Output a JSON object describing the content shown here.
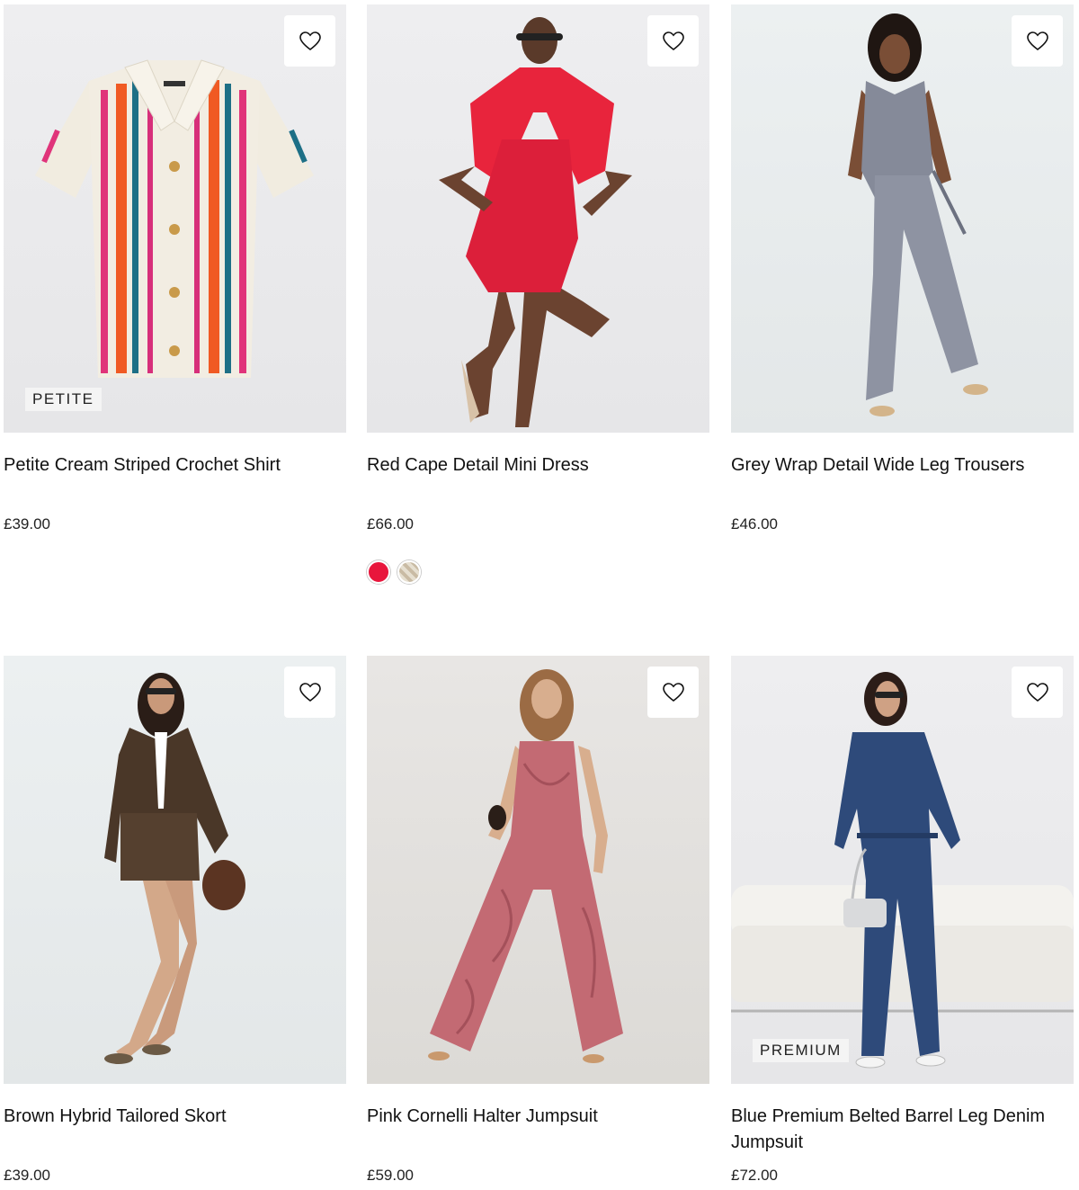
{
  "products": [
    {
      "title": "Petite Cream Striped Crochet Shirt",
      "price": "£39.00",
      "badge": "PETITE"
    },
    {
      "title": "Red Cape Detail Mini Dress",
      "price": "£66.00",
      "swatches": [
        "#e8163c",
        "#c9bba4"
      ]
    },
    {
      "title": "Grey Wrap Detail Wide Leg Trousers",
      "price": "£46.00"
    },
    {
      "title": "Brown Hybrid Tailored Skort",
      "price": "£39.00"
    },
    {
      "title": "Pink Cornelli Halter Jumpsuit",
      "price": "£59.00"
    },
    {
      "title": "Blue Premium Belted Barrel Leg Denim Jumpsuit",
      "price": "£72.00",
      "badge": "PREMIUM"
    }
  ]
}
